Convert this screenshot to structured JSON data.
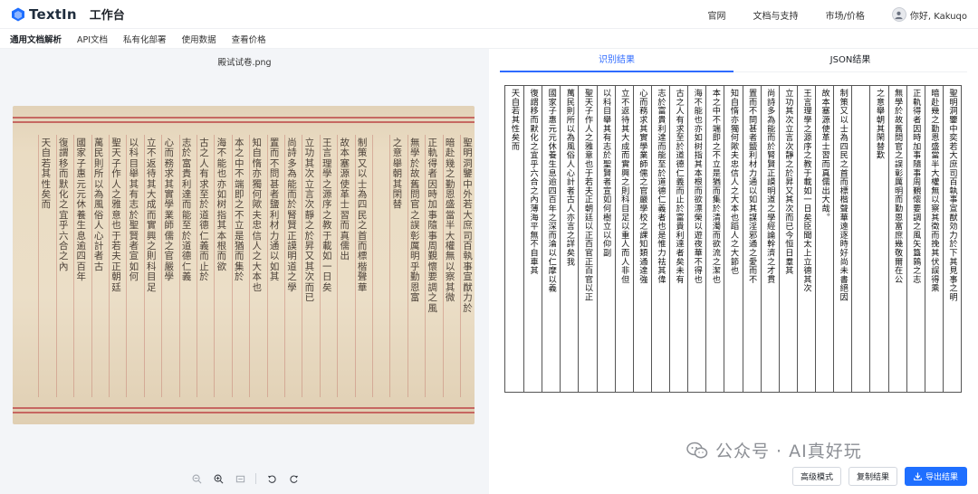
{
  "header": {
    "brand": "TextIn",
    "workbench": "工作台",
    "nav": [
      "官网",
      "文档与支持",
      "市场/价格"
    ],
    "user_greeting": "你好, Kakuqo"
  },
  "subnav": [
    "通用文档解析",
    "API文档",
    "私有化部署",
    "使用数据",
    "查看价格"
  ],
  "left": {
    "file_name": "殿试试卷.png",
    "scroll_columns": [
      "聖明洞鑒中外若大庶司百執事宣猷力於",
      "暗赴幾之勤恩盛當半大權無以察其微",
      "正軌得者因時加事隨事周覲懷要調之風",
      "無學於故舊問官之誤彰厲明乎勤恩富",
      "之意舉朝其閑替",
      "",
      "制策又以士為四民之首而標楷聲華",
      "故本塞源使革士習而真儒出",
      "王言理學之源序之教于載如一日矣",
      "立功其次立言次靜之於昇又其次而已",
      "尚詩多為能而於腎賢正謨明道之學",
      "置而不問甚者鹽利材力通以如其",
      "知自惰亦獨何歟夫忠信人之大本也",
      "本之中不端即之不立是猶而集於",
      "海不能也亦如树指其本根而欲",
      "古之人有求至於道德仁義而止於",
      "志於富貴利達而能至於道德仁義",
      "心而務求其實學業師儒之官嚴學",
      "立不返待其大成而實興之則科目足",
      "以科目舉其有志於聖賢者宣如何",
      "聖天子作人之雅意也于若夫正朝廷",
      "萬民則所以為風俗人心計者古",
      "國家子惠元元休養生息逾四百年",
      "復謂移而默化之宜乎六合之內",
      "天自若其性矣而"
    ],
    "zoom_tools": [
      "zoom-out-icon",
      "zoom-in-icon",
      "fit-icon",
      "rotate-left-icon",
      "rotate-right-icon"
    ]
  },
  "right": {
    "tabs": [
      "识别结果",
      "JSON结果"
    ],
    "active_tab": 0,
    "columns": [
      "聖明洞鑒中奕若大庶司百執事宣猷効力於下其見事之明",
      "暗赴幾之勤恩盛當半大權無以察其徵而挽其伏誤得乘",
      "正軌得者因時加事隨事周覲懷要調之風矢簋鶉之志",
      "無學於故舊問官之誤彰厲明而勤恩富庶幾敬爾在公",
      "之意舉朝其閑替歎",
      "",
      "制策又以士為四民之首而標楷聲華遠逐時好尚未書絕因",
      "故本塞源使革士習而真儒出大哉。",
      "王言理學之源序之教于載如一日矣臣聞太上立德其次",
      "立功其次立言次靜之於昇又其次而已今恒日羣其",
      "尚詩多為能而於腎賢正謨明道之學經論幹濟之才貫",
      "置而不問甚者鹽利材力通以如其謀淫邪通之愛而不",
      "知自惰亦獨何歟夫忠信人之大本也蹈人之大節也",
      "本之中不端即之不立是猶而集於清濁而欲流之潔也",
      "海不能也亦如树指其本根而欲漂榮以遊夜華不得也",
      "古之人有求至於道德仁義而止於富貴利達者矣未有",
      "志於富貴利達而能至於道德仁義者也是惟力祛其偉",
      "心而務求其實學業師儒之官嚴學校之課知類通達強",
      "立不返待其大成而實興之則科目足以重人而人非但",
      "以科目舉其有志於聖賢者宣如何樹立以仰副",
      "聖天子作人之雅意也于若夫正朝廷以正百官正百官以正",
      "萬民則所以為風俗人心計者古人亦言之詳矣我",
      "國家子惠元元休養生息逾四百年之深而淪以仁摩以義",
      "復謂移而默化之宜乎六合之內薄海平無不自車其",
      "天自若其性矣而"
    ],
    "buttons": {
      "advanced": "高级模式",
      "copy": "复制结果",
      "export": "导出结果"
    }
  },
  "watermark": "公众号 · AI真好玩",
  "colors": {
    "brand": "#1f6fff",
    "tab_active": "#2f6bff",
    "rule_red": "#c15552",
    "paper": "#ebdec7"
  }
}
